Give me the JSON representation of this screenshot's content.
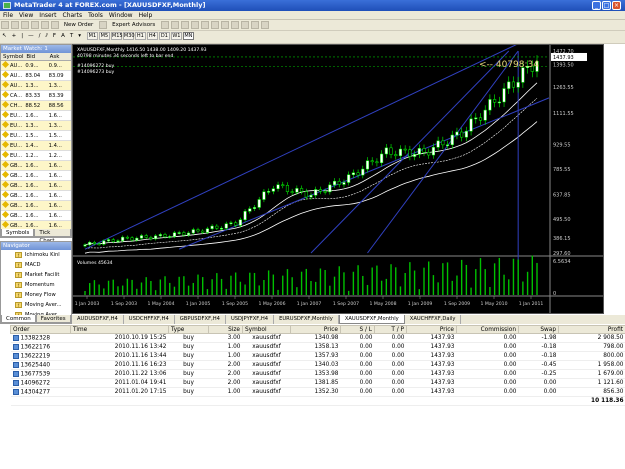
{
  "window": {
    "title": "MetaTrader 4 at FOREX.com - [XAUUSDFXF,Monthly]"
  },
  "menu": [
    "File",
    "View",
    "Insert",
    "Charts",
    "Tools",
    "Window",
    "Help"
  ],
  "toolbar": {
    "new_order": "New Order",
    "expert_advisors": "Expert Advisors",
    "timeframes": [
      "M1",
      "M5",
      "M15",
      "M30",
      "H1",
      "H4",
      "D1",
      "W1",
      "MN"
    ],
    "active_tf": "MN"
  },
  "market_watch": {
    "title": "Market Watch: 1",
    "columns": [
      "Symbol",
      "Bid",
      "Ask"
    ],
    "rows": [
      [
        "AU...",
        "0.9...",
        "0.9..."
      ],
      [
        "AU...",
        "83.04",
        "83.09"
      ],
      [
        "AU...",
        "1.3...",
        "1.3..."
      ],
      [
        "CA...",
        "83.33",
        "83.39"
      ],
      [
        "CH...",
        "88.52",
        "88.56"
      ],
      [
        "EU...",
        "1.6...",
        "1.6..."
      ],
      [
        "EU...",
        "1.3...",
        "1.3..."
      ],
      [
        "EU...",
        "1.5...",
        "1.5..."
      ],
      [
        "EU...",
        "1.4...",
        "1.4..."
      ],
      [
        "EU...",
        "1.2...",
        "1.2..."
      ],
      [
        "GB...",
        "1.6...",
        "1.6..."
      ],
      [
        "GB...",
        "1.6...",
        "1.6..."
      ],
      [
        "GB...",
        "1.6...",
        "1.6..."
      ],
      [
        "GB...",
        "1.6...",
        "1.6..."
      ],
      [
        "GB...",
        "1.6...",
        "1.6..."
      ],
      [
        "GB...",
        "1.6...",
        "1.6..."
      ],
      [
        "GB...",
        "1.6...",
        "1.6..."
      ]
    ],
    "tabs": [
      "Symbols",
      "Tick Chart"
    ]
  },
  "navigator": {
    "title": "Navigator",
    "items": [
      "Ichimoku Kinl",
      "MACD",
      "Market Facilit",
      "Momentum",
      "Money Flow",
      "Moving Aver...",
      "Moving Aver..."
    ],
    "tabs": [
      "Common",
      "Favorites"
    ]
  },
  "chart": {
    "header_lines": [
      "XAUUSDFXF,Monthly  1416.50 1438.00 1409.20 1437.93",
      "40798 minutes 34 seconds left to bar end"
    ],
    "order_labels": [
      "#14096272 buy",
      "#14096273 buy"
    ],
    "countdown": "<-- 40798:34",
    "price_axis": [
      "1472.70",
      "1437.93",
      "1393.50",
      "1263.55",
      "1111.55",
      "929.55",
      "785.55",
      "637.85",
      "495.50",
      "386.15",
      "297.60"
    ],
    "price_tag": "1437.93",
    "volume_label": "Volumes 45634",
    "volume_axis": [
      "6.5634",
      "0"
    ],
    "time_axis": [
      "1 Jan 2003",
      "1 Sep 2003",
      "1 May 2004",
      "1 Jan 2005",
      "1 Sep 2005",
      "1 May 2006",
      "1 Jan 2007",
      "1 Sep 2007",
      "1 May 2008",
      "1 Jan 2009",
      "1 Sep 2009",
      "1 May 2010",
      "1 Jan 2011"
    ]
  },
  "chart_tabs": [
    "AUDUSDFXF,H4",
    "USDCHFFXF,H4",
    "GBPUSDFXF,H4",
    "USDJPYFXF,H4",
    "EURUSDFXF,Monthly",
    "XAUUSDFXF,Monthly",
    "XAUCHFFXF,Daily"
  ],
  "active_chart_tab": "XAUUSDFXF,Monthly",
  "terminal": {
    "columns": [
      "Order",
      "Time",
      "Type",
      "Size",
      "Symbol",
      "Price",
      "S / L",
      "T / P",
      "Price",
      "Commission",
      "Swap",
      "Profit"
    ],
    "rows": [
      [
        "13382328",
        "2010.10.19 15:25",
        "buy",
        "3.00",
        "xauusdfxf",
        "1340.98",
        "0.00",
        "0.00",
        "1437.93",
        "0.00",
        "-1.98",
        "2 908.50"
      ],
      [
        "13622176",
        "2010.11.16 13:42",
        "buy",
        "1.00",
        "xauusdfxf",
        "1358.13",
        "0.00",
        "0.00",
        "1437.93",
        "0.00",
        "-0.18",
        "798.00"
      ],
      [
        "13622219",
        "2010.11.16 13:44",
        "buy",
        "1.00",
        "xauusdfxf",
        "1357.93",
        "0.00",
        "0.00",
        "1437.93",
        "0.00",
        "-0.18",
        "800.00"
      ],
      [
        "13625440",
        "2010.11.16 16:23",
        "buy",
        "2.00",
        "xauusdfxf",
        "1340.03",
        "0.00",
        "0.00",
        "1437.93",
        "0.00",
        "-0.45",
        "1 958.00"
      ],
      [
        "13677539",
        "2010.11.22 13:06",
        "buy",
        "2.00",
        "xauusdfxf",
        "1353.98",
        "0.00",
        "0.00",
        "1437.93",
        "0.00",
        "-0.25",
        "1 679.00"
      ],
      [
        "14096272",
        "2011.01.04 19:41",
        "buy",
        "2.00",
        "xauusdfxf",
        "1381.85",
        "0.00",
        "0.00",
        "1437.93",
        "0.00",
        "0.00",
        "1 121.60"
      ],
      [
        "14304277",
        "2011.01.20 17:15",
        "buy",
        "1.00",
        "xauusdfxf",
        "1352.30",
        "0.00",
        "0.00",
        "1437.93",
        "0.00",
        "0.00",
        "856.30"
      ]
    ],
    "total": "10 118.36"
  },
  "chart_data": {
    "type": "line",
    "title": "XAUUSDFXF,Monthly",
    "x": [
      "1 Jan 2003",
      "1 Sep 2003",
      "1 May 2004",
      "1 Jan 2005",
      "1 Sep 2005",
      "1 May 2006",
      "1 Jan 2007",
      "1 Sep 2007",
      "1 May 2008",
      "1 Jan 2009",
      "1 Sep 2009",
      "1 May 2010",
      "1 Jan 2011"
    ],
    "series": [
      {
        "values": [
          345,
          380,
          395,
          425,
          470,
          690,
          635,
          735,
          885,
          880,
          995,
          1210,
          1420
        ]
      }
    ],
    "ylim": [
      297.6,
      1472.7
    ],
    "grid": false
  },
  "colors": {
    "bull": "#ffffff",
    "bear": "#00ff00",
    "countdown": "#e6d87a",
    "volume": "#00c000"
  }
}
